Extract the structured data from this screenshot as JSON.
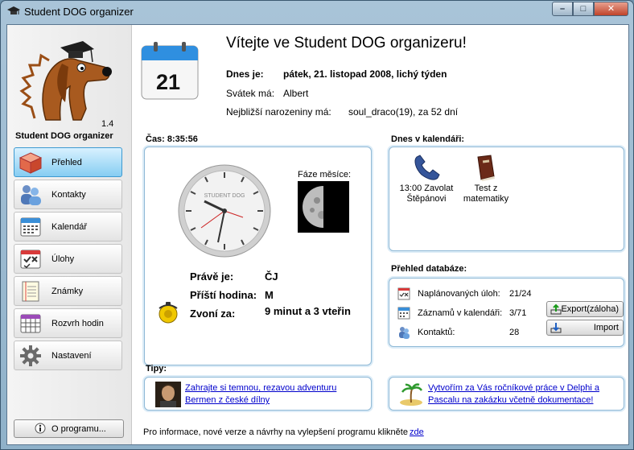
{
  "window": {
    "title": "Student DOG organizer",
    "controls": {
      "minimize": "–",
      "maximize": "□",
      "close": "✕"
    }
  },
  "sidebar": {
    "version": "1.4",
    "app_name": "Student DOG organizer",
    "items": [
      {
        "label": "Přehled",
        "icon": "box-icon",
        "active": true
      },
      {
        "label": "Kontakty",
        "icon": "contacts-icon",
        "active": false
      },
      {
        "label": "Kalendář",
        "icon": "calendar-icon",
        "active": false
      },
      {
        "label": "Úlohy",
        "icon": "tasks-icon",
        "active": false
      },
      {
        "label": "Známky",
        "icon": "notebook-icon",
        "active": false
      },
      {
        "label": "Rozvrh hodin",
        "icon": "timetable-icon",
        "active": false
      },
      {
        "label": "Nastavení",
        "icon": "gear-icon",
        "active": false
      }
    ],
    "about_label": "O programu..."
  },
  "header": {
    "calendar_day": "21",
    "welcome": "Vítejte ve Student DOG organizeru!",
    "today_label": "Dnes je:",
    "today_value": "pátek, 21. listopad 2008, lichý týden",
    "nameday_label": "Svátek má:",
    "nameday_value": "Albert",
    "birthday_label": "Nejbližší narozeniny má:",
    "birthday_value": "soul_draco(19), za 52 dní"
  },
  "time_panel": {
    "time_label": "Čas: 8:35:56",
    "clock_brand": "STUDENT DOG",
    "moon_label": "Fáze měsíce:",
    "current_label": "Právě je:",
    "current_value": "ČJ",
    "next_label": "Příští hodina:",
    "next_value": "M",
    "bell_label": "Zvoní za:",
    "bell_value": "9 minut a 3 vteřin"
  },
  "calendar_today": {
    "label": "Dnes v kalendáři:",
    "events": [
      {
        "text1": "13:00 Zavolat",
        "text2": "Štěpánovi",
        "icon": "phone-icon"
      },
      {
        "text1": "Test z",
        "text2": "matematiky",
        "icon": "book-icon"
      }
    ]
  },
  "database": {
    "label": "Přehled databáze:",
    "rows": [
      {
        "label": "Naplánovaných úloh:",
        "value": "21/24"
      },
      {
        "label": "Záznamů v kalendáři:",
        "value": "3/71"
      },
      {
        "label": "Kontaktů:",
        "value": "28"
      }
    ],
    "export_label": "Export(záloha)",
    "import_label": "Import"
  },
  "tips": {
    "label": "Tipy:",
    "left_line1": "Zahrajte si temnou, rezavou adventuru",
    "left_line2": "Bermen z české dílny",
    "right_line1": "Vytvořím za Vás ročníkové práce v Delphi a",
    "right_line2": "Pascalu na zakázku včetně dokumentace!"
  },
  "footer": {
    "text": "Pro informace, nové verze a návrhy na vylepšení programu klikněte",
    "link": "zde"
  }
}
